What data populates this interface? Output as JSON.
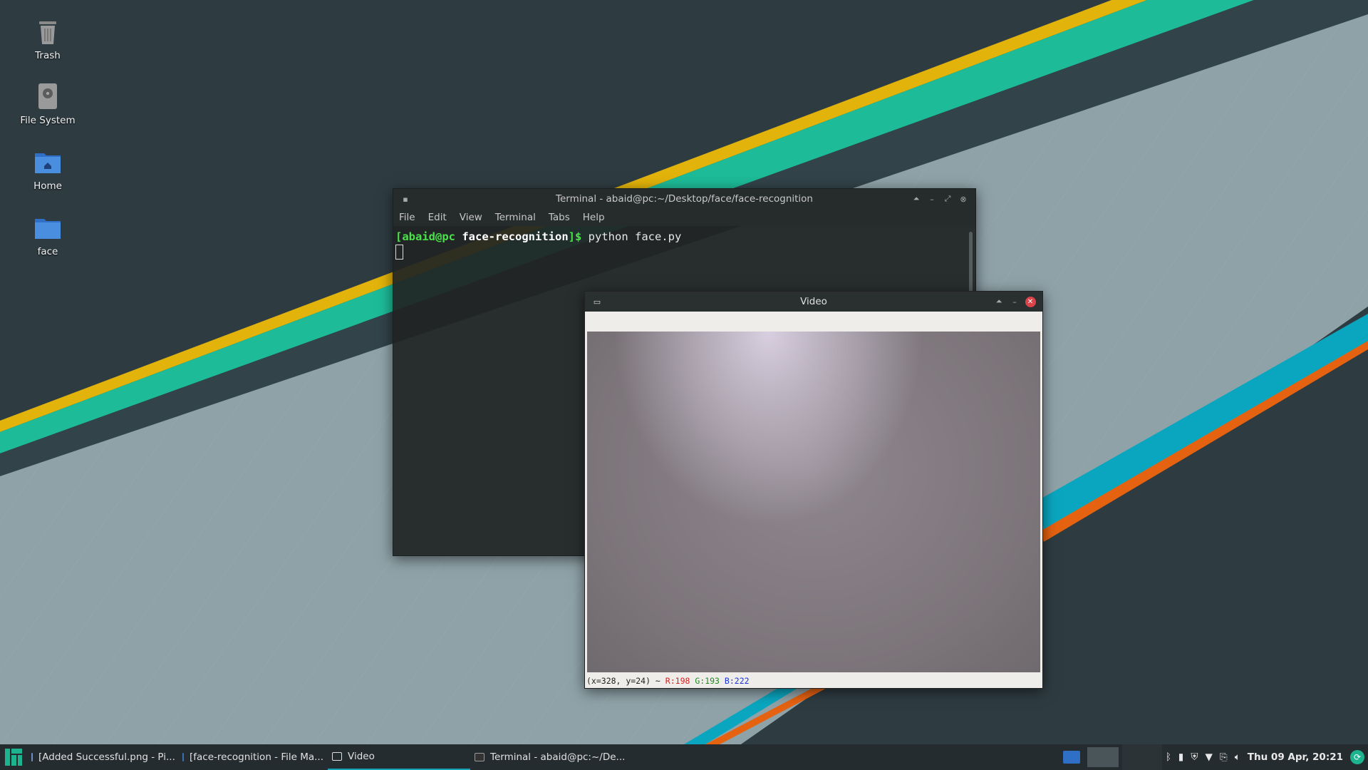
{
  "desktop": {
    "icons": [
      {
        "label": "Trash",
        "icon": "trash-icon"
      },
      {
        "label": "File System",
        "icon": "drive-icon"
      },
      {
        "label": "Home",
        "icon": "home-folder-icon"
      },
      {
        "label": "face",
        "icon": "folder-icon"
      }
    ]
  },
  "terminal": {
    "title": "Terminal - abaid@pc:~/Desktop/face/face-recognition",
    "menu": [
      "File",
      "Edit",
      "View",
      "Terminal",
      "Tabs",
      "Help"
    ],
    "prompt_user": "[abaid@pc",
    "prompt_dir": "face-recognition",
    "prompt_end": "]$",
    "command": "python face.py"
  },
  "video": {
    "title": "Video",
    "status_coords": "(x=328, y=24) ~",
    "status_r": "R:198",
    "status_g": "G:193",
    "status_b": "B:222"
  },
  "taskbar": {
    "items": [
      {
        "label": "[Added Successful.png - Pi...",
        "active": false
      },
      {
        "label": "[face-recognition - File Ma...",
        "active": false
      },
      {
        "label": "Video",
        "active": true
      },
      {
        "label": "Terminal - abaid@pc:~/De...",
        "active": false
      }
    ],
    "clock": "Thu 09 Apr, 20:21"
  },
  "colors": {
    "accent": "#16a3b3",
    "stripe_yellow": "#e2b30a",
    "stripe_teal": "#1dbb98",
    "stripe_blue": "#0aa6c0",
    "stripe_orange": "#e56211"
  }
}
